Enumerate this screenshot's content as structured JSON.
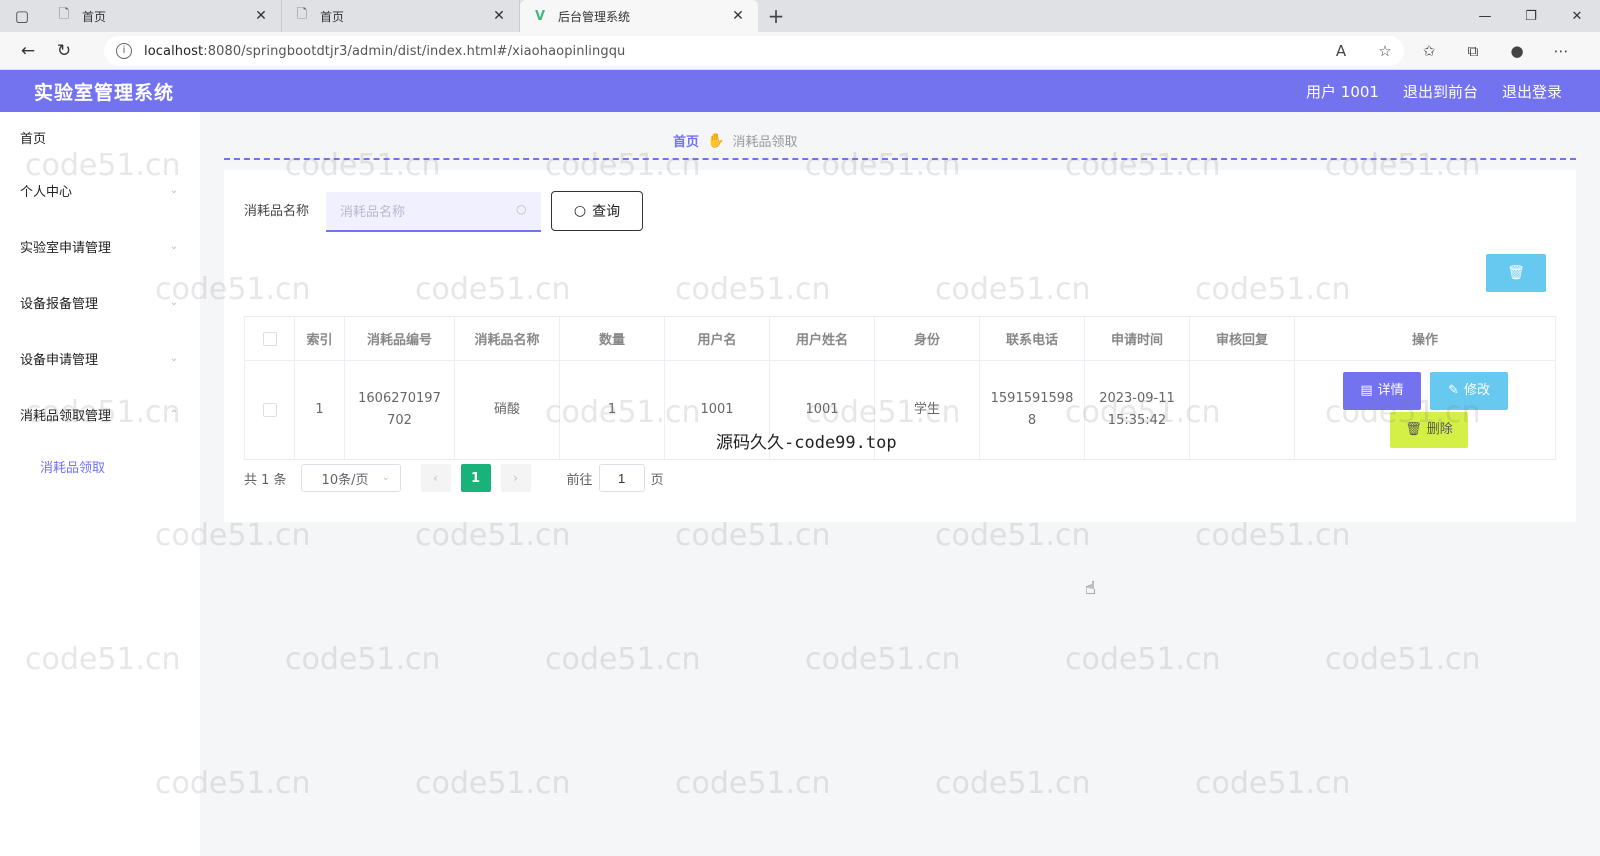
{
  "browser": {
    "tabs": [
      {
        "title": "首页",
        "active": false,
        "icon": "page-icon"
      },
      {
        "title": "首页",
        "active": false,
        "icon": "page-icon"
      },
      {
        "title": "后台管理系统",
        "active": true,
        "icon": "vue-logo-icon"
      }
    ],
    "url_host": "localhost",
    "url_rest": ":8080/springbootdtjr3/admin/dist/index.html#/xiaohaopinlingqu"
  },
  "header": {
    "title": "实验室管理系统",
    "user": "用户 1001",
    "to_front": "退出到前台",
    "logout": "退出登录",
    "bg_color": "#7373f0"
  },
  "sidebar": {
    "items": [
      {
        "label": "首页"
      },
      {
        "label": "个人中心"
      },
      {
        "label": "实验室申请管理"
      },
      {
        "label": "设备报备管理"
      },
      {
        "label": "设备申请管理"
      },
      {
        "label": "消耗品领取管理"
      }
    ],
    "sub_item": "消耗品领取"
  },
  "breadcrumb": {
    "home": "首页",
    "current": "消耗品领取"
  },
  "search": {
    "label": "消耗品名称",
    "placeholder": "消耗品名称",
    "button": "查询"
  },
  "table": {
    "headers": [
      "索引",
      "消耗品编号",
      "消耗品名称",
      "数量",
      "用户名",
      "用户姓名",
      "身份",
      "联系电话",
      "申请时间",
      "审核回复",
      "操作"
    ],
    "rows": [
      {
        "index": "1",
        "code_line1": "1606270197",
        "code_line2": "702",
        "name": "硝酸",
        "quantity": "1",
        "username": "1001",
        "realname": "1001",
        "role": "学生",
        "phone_line1": "1591591598",
        "phone_line2": "8",
        "time_line1": "2023-09-11",
        "time_line2": "15:35:42",
        "reply": ""
      }
    ],
    "actions": {
      "detail": "详情",
      "edit": "修改",
      "delete": "删除"
    }
  },
  "pagination": {
    "total": "共 1 条",
    "page_size": "10条/页",
    "current_page": "1",
    "goto_label": "前往",
    "goto_value": "1",
    "page_suffix": "页"
  },
  "watermark": {
    "text": "code51.cn",
    "center_text": "源码久久-code99.top"
  }
}
